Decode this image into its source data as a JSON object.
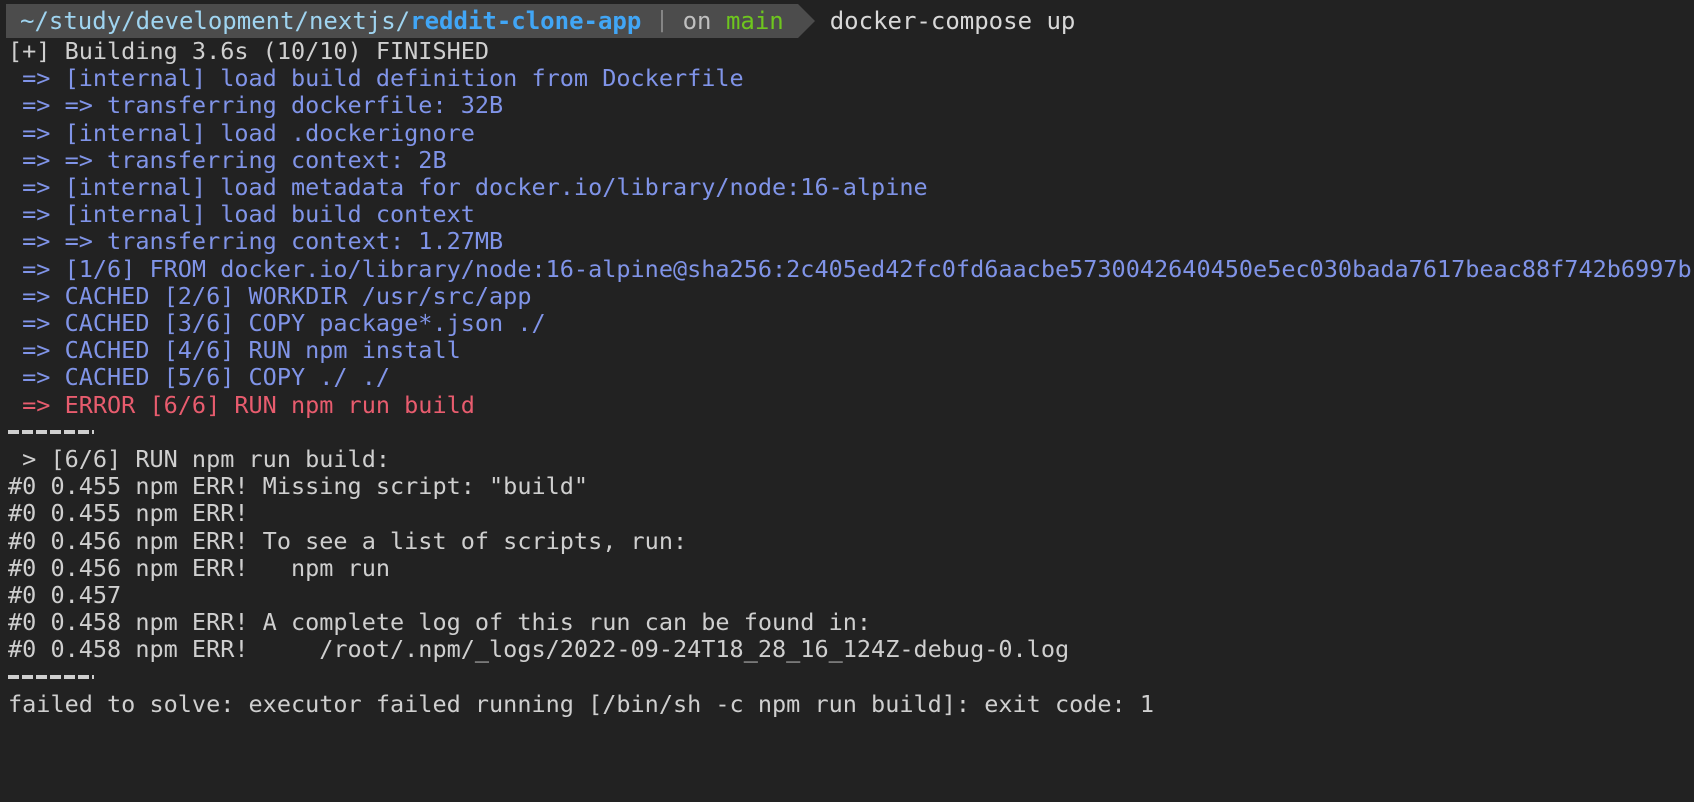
{
  "terminal": {
    "background_color": "#222222",
    "foreground_color": "#d8d8d8",
    "accent_blue": "#8094e8",
    "accent_red": "#e85c6e",
    "accent_green": "#6ec61e",
    "accent_cyan": "#41a6f6",
    "prompt_segment_bg": "#4c4c4c"
  },
  "prompt": {
    "path_prefix": "~/study/development/nextjs/",
    "repo_name": "reddit-clone-app",
    "divider": "|",
    "branch_label": "on ",
    "branch_name": "main",
    "command": "docker-compose up"
  },
  "output": {
    "lines": [
      {
        "text": "[+] Building 3.6s (10/10) FINISHED",
        "color": "c-grey"
      },
      {
        "text": " => [internal] load build definition from Dockerfile",
        "color": "c-blue"
      },
      {
        "text": " => => transferring dockerfile: 32B",
        "color": "c-blue"
      },
      {
        "text": " => [internal] load .dockerignore",
        "color": "c-blue"
      },
      {
        "text": " => => transferring context: 2B",
        "color": "c-blue"
      },
      {
        "text": " => [internal] load metadata for docker.io/library/node:16-alpine",
        "color": "c-blue"
      },
      {
        "text": " => [internal] load build context",
        "color": "c-blue"
      },
      {
        "text": " => => transferring context: 1.27MB",
        "color": "c-blue"
      },
      {
        "text": " => [1/6] FROM docker.io/library/node:16-alpine@sha256:2c405ed42fc0fd6aacbe5730042640450e5ec030bada7617beac88f742b6997b",
        "color": "c-blue"
      },
      {
        "text": " => CACHED [2/6] WORKDIR /usr/src/app",
        "color": "c-blue"
      },
      {
        "text": " => CACHED [3/6] COPY package*.json ./",
        "color": "c-blue"
      },
      {
        "text": " => CACHED [4/6] RUN npm install",
        "color": "c-blue"
      },
      {
        "text": " => CACHED [5/6] COPY ./ ./",
        "color": "c-blue"
      },
      {
        "text": " => ERROR [6/6] RUN npm run build",
        "color": "c-red"
      },
      {
        "rule": true
      },
      {
        "text": " > [6/6] RUN npm run build:",
        "color": "c-grey"
      },
      {
        "text": "#0 0.455 npm ERR! Missing script: \"build\"",
        "color": "c-grey"
      },
      {
        "text": "#0 0.455 npm ERR!",
        "color": "c-grey"
      },
      {
        "text": "#0 0.456 npm ERR! To see a list of scripts, run:",
        "color": "c-grey"
      },
      {
        "text": "#0 0.456 npm ERR!   npm run",
        "color": "c-grey"
      },
      {
        "text": "#0 0.457",
        "color": "c-grey"
      },
      {
        "text": "#0 0.458 npm ERR! A complete log of this run can be found in:",
        "color": "c-grey"
      },
      {
        "text": "#0 0.458 npm ERR!     /root/.npm/_logs/2022-09-24T18_28_16_124Z-debug-0.log",
        "color": "c-grey"
      },
      {
        "rule": true
      },
      {
        "text": "failed to solve: executor failed running [/bin/sh -c npm run build]: exit code: 1",
        "color": "c-grey"
      }
    ]
  }
}
